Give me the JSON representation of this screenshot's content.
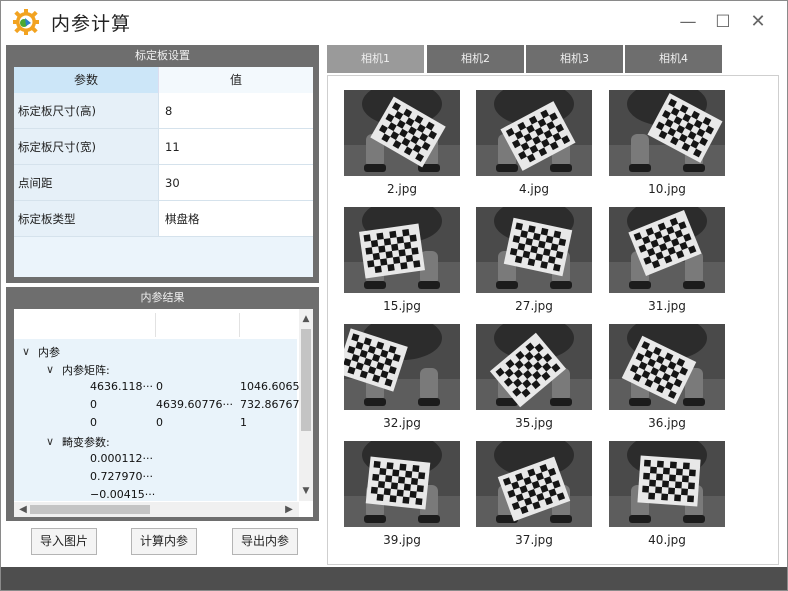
{
  "window": {
    "title": "内参计算",
    "minimize": "—",
    "maximize": "☐",
    "close": "✕"
  },
  "calib_panel": {
    "title": "标定板设置",
    "header_param": "参数",
    "header_value": "值",
    "rows": [
      {
        "label": "标定板尺寸(高)",
        "value": "8"
      },
      {
        "label": "标定板尺寸(宽)",
        "value": "11"
      },
      {
        "label": "点间距",
        "value": "30"
      },
      {
        "label": "标定板类型",
        "value": "棋盘格"
      }
    ]
  },
  "result_panel": {
    "title": "内参结果",
    "root": "内参",
    "matrix_label": "内参矩阵:",
    "matrix": [
      [
        "4636.118···",
        "0",
        "1046.6065"
      ],
      [
        "0",
        "4639.60776···",
        "732.86767"
      ],
      [
        "0",
        "0",
        "1"
      ]
    ],
    "distortion_label": "畸变参数:",
    "distortion": [
      "0.000112···",
      "0.727970···",
      "−0.00415···"
    ]
  },
  "buttons": {
    "import": "导入图片",
    "compute": "计算内参",
    "export": "导出内参"
  },
  "tabs": [
    "相机1",
    "相机2",
    "相机3",
    "相机4"
  ],
  "images": [
    "2.jpg",
    "4.jpg",
    "10.jpg",
    "15.jpg",
    "27.jpg",
    "31.jpg",
    "32.jpg",
    "35.jpg",
    "36.jpg",
    "39.jpg",
    "37.jpg",
    "40.jpg"
  ],
  "colors": {
    "panel_dark": "#6e6e6e",
    "tab_active": "#9a9a9a",
    "table_header": "#cce6f8",
    "status_bar": "#4e4e4e"
  }
}
